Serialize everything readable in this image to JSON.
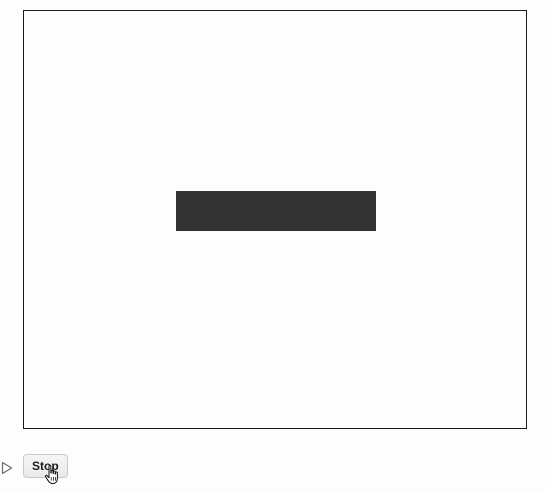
{
  "controls": {
    "run_icon": "play-outline-icon",
    "stop_label": "Stop",
    "cursor_icon": "hand-pointer-icon"
  },
  "canvas": {
    "background": "#fdfdfd",
    "border_color": "#1a1a1a",
    "shape_color": "#333333"
  }
}
